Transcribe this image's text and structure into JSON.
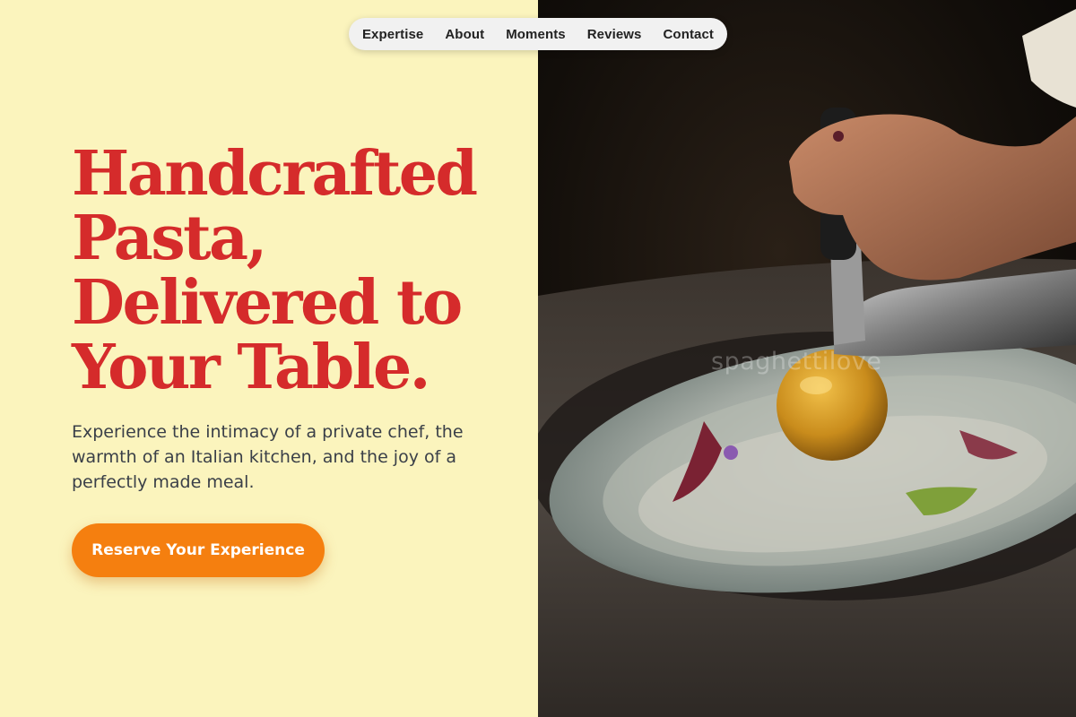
{
  "nav": {
    "items": [
      {
        "label": "Expertise"
      },
      {
        "label": "About"
      },
      {
        "label": "Moments"
      },
      {
        "label": "Reviews"
      },
      {
        "label": "Contact"
      }
    ]
  },
  "hero": {
    "headline_lines": [
      "Handcrafted",
      "Pasta,",
      "Delivered to",
      "Your Table."
    ],
    "subtext": "Experience the intimacy of a private chef, the warmth of an Italian kitchen, and the joy of a perfectly made meal.",
    "cta_label": "Reserve Your Experience"
  },
  "image": {
    "watermark": "spaghettilove",
    "description_icon": "plated-dish-photo"
  },
  "colors": {
    "background": "#fbf4bd",
    "headline": "#d52b2b",
    "cta": "#f57f0f",
    "body_text": "#3a3f48"
  }
}
